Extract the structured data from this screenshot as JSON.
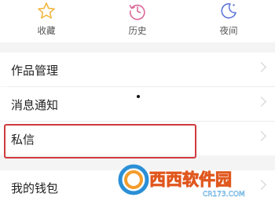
{
  "quick_actions": [
    {
      "label": "收藏",
      "icon": "star-icon"
    },
    {
      "label": "历史",
      "icon": "history-clock-icon"
    },
    {
      "label": "夜间",
      "icon": "night-moon-icon"
    }
  ],
  "menu": [
    {
      "label": "作品管理"
    },
    {
      "label": "消息通知"
    },
    {
      "label": "私信",
      "highlighted": true
    },
    {
      "label": "我的钱包"
    }
  ],
  "colors": {
    "star": "#f2b740",
    "history": "#d9699a",
    "night": "#5e76d8",
    "highlight": "#d03a3e"
  },
  "watermark": {
    "brand": "西西软件园",
    "domain": "CR173.COM"
  }
}
